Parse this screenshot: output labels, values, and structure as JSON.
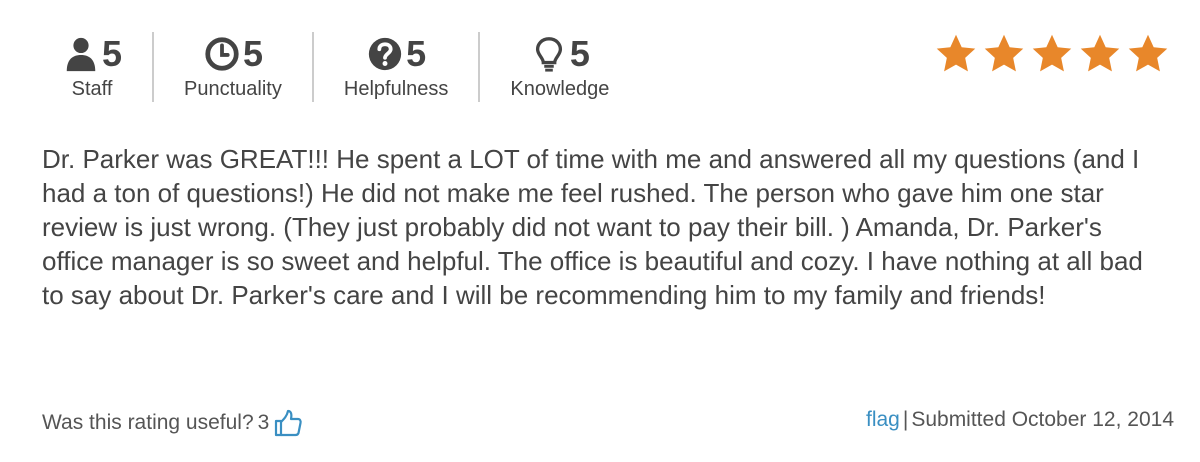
{
  "metrics": [
    {
      "icon": "person-icon",
      "value": "5",
      "label": "Staff"
    },
    {
      "icon": "clock-icon",
      "value": "5",
      "label": "Punctuality"
    },
    {
      "icon": "question-circle-icon",
      "value": "5",
      "label": "Helpfulness"
    },
    {
      "icon": "lightbulb-icon",
      "value": "5",
      "label": "Knowledge"
    }
  ],
  "rating": {
    "stars": 5,
    "max": 5,
    "star_color": "#e8872a"
  },
  "review": {
    "text": "Dr. Parker was GREAT!!! He spent a LOT of time with me and answered all my questions (and I had a ton of questions!) He did not make me feel rushed. The person who gave him one star review is just wrong. (They just probably did not want to pay their bill. ) Amanda, Dr. Parker's office manager is so sweet and helpful. The office is beautiful and cozy. I have nothing at all bad to say about Dr. Parker's care and I will be recommending him to my family and friends!"
  },
  "footer": {
    "useful_prompt": "Was this rating useful?",
    "useful_count": "3",
    "thumb_icon": "thumbs-up-icon",
    "flag_label": "flag",
    "separator": "|",
    "submitted": "Submitted October 12, 2014",
    "link_color": "#3a8fc2"
  }
}
